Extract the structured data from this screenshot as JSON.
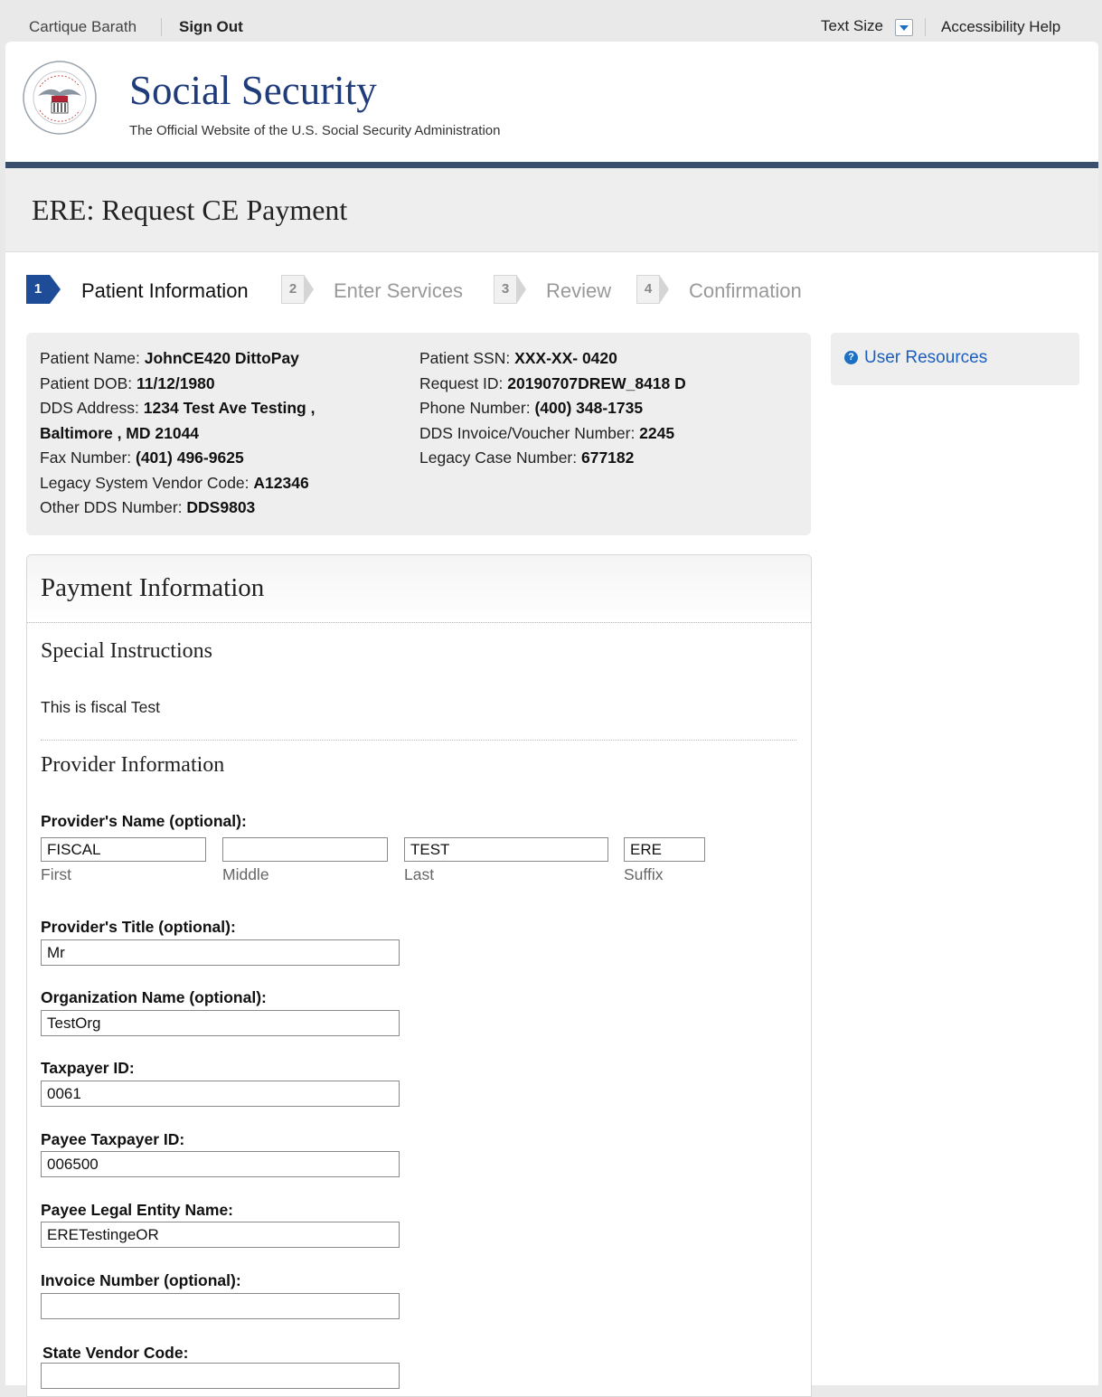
{
  "topbar": {
    "user_name": "Cartique Barath",
    "sign_out": "Sign Out",
    "text_size": "Text Size",
    "accessibility": "Accessibility Help"
  },
  "header": {
    "brand": "Social Security",
    "tagline": "The Official Website of the U.S. Social Security Administration",
    "seal_text": "SOCIAL SECURITY ADMINISTRATION USA"
  },
  "page": {
    "title": "ERE: Request CE Payment"
  },
  "steps": [
    {
      "num": "1",
      "label": "Patient Information",
      "state": "active"
    },
    {
      "num": "2",
      "label": "Enter Services",
      "state": "inactive"
    },
    {
      "num": "3",
      "label": "Review",
      "state": "inactive"
    },
    {
      "num": "4",
      "label": "Confirmation",
      "state": "inactive"
    }
  ],
  "patient": {
    "name_label": "Patient Name: ",
    "name": "JohnCE420 DittoPay",
    "dob_label": "Patient DOB: ",
    "dob": "11/12/1980",
    "dds_address_label": "DDS Address: ",
    "dds_address_1": "1234 Test Ave Testing ,",
    "dds_address_2": "Baltimore , MD 21044",
    "fax_label": "Fax Number: ",
    "fax": "(401) 496-9625",
    "legacy_vendor_label": "Legacy System Vendor Code: ",
    "legacy_vendor": "A12346",
    "other_dds_label": "Other DDS Number: ",
    "other_dds": "DDS9803",
    "ssn_label": "Patient SSN: ",
    "ssn": "XXX-XX- 0420",
    "request_id_label": "Request ID: ",
    "request_id": "20190707DREW_8418 D",
    "phone_label": "Phone Number: ",
    "phone": "(400) 348-1735",
    "invoice_voucher_label": "DDS Invoice/Voucher Number: ",
    "invoice_voucher": "2245",
    "legacy_case_label": "Legacy Case Number: ",
    "legacy_case": "677182"
  },
  "sidebar": {
    "user_resources": "User Resources"
  },
  "payment": {
    "heading": "Payment Information",
    "special_heading": "Special Instructions",
    "special_text": "This is fiscal Test",
    "provider_heading": "Provider Information",
    "provider_name_label": "Provider's Name (optional):",
    "name_first": "FISCAL",
    "name_middle": "",
    "name_last": "TEST",
    "name_suffix": "ERE",
    "first_caption": "First",
    "middle_caption": "Middle",
    "last_caption": "Last",
    "suffix_caption": "Suffix",
    "title_label": "Provider's Title (optional):",
    "title_value": "Mr",
    "org_label": "Organization Name (optional):",
    "org_value": "TestOrg",
    "taxpayer_label": "Taxpayer ID:",
    "taxpayer_value": "0061",
    "payee_taxpayer_label": "Payee Taxpayer ID:",
    "payee_taxpayer_value": "006500",
    "payee_legal_label": "Payee Legal Entity Name:",
    "payee_legal_value": "ERETestingeOR",
    "invoice_label": "Invoice Number (optional):",
    "invoice_value": "",
    "state_vendor_label": "State Vendor Code:",
    "state_vendor_value": ""
  },
  "colors": {
    "brand_blue": "#1f3b7a",
    "step_active": "#1f4c96",
    "link_blue": "#1c5fbf",
    "header_rule": "#3a4e6e"
  }
}
